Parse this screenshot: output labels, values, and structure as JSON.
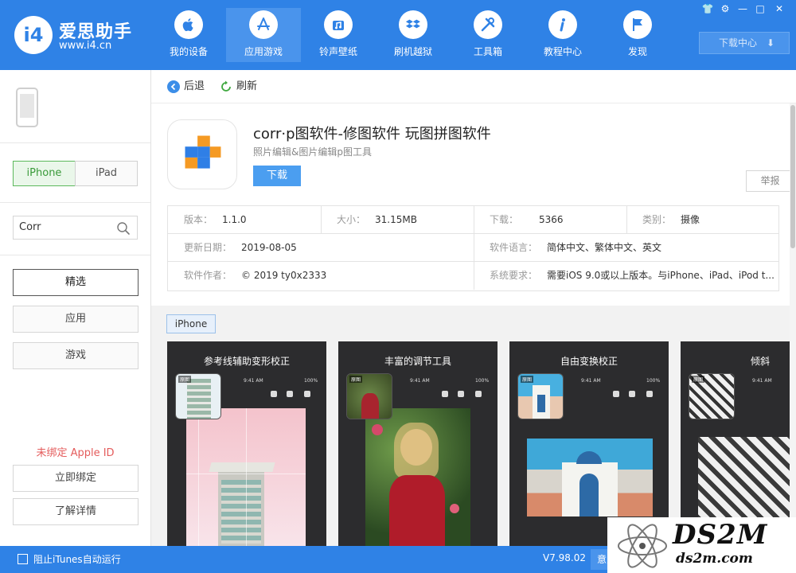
{
  "app": {
    "logo_badge": "i4",
    "name": "爱思助手",
    "url": "www.i4.cn"
  },
  "nav": {
    "items": [
      {
        "label": "我的设备",
        "icon": "apple-icon"
      },
      {
        "label": "应用游戏",
        "icon": "app-store-icon"
      },
      {
        "label": "铃声壁纸",
        "icon": "music-icon"
      },
      {
        "label": "刷机越狱",
        "icon": "dropbox-box-icon"
      },
      {
        "label": "工具箱",
        "icon": "tools-icon"
      },
      {
        "label": "教程中心",
        "icon": "info-icon"
      },
      {
        "label": "发现",
        "icon": "flag-icon"
      }
    ],
    "active_index": 1
  },
  "window_controls": {
    "shirt": "👕",
    "settings": "⚙",
    "minimize": "—",
    "maximize": "□",
    "close": "✕"
  },
  "download_center": {
    "label": "下载中心",
    "arrow": "⬇"
  },
  "sidebar": {
    "device_tabs": [
      "iPhone",
      "iPad"
    ],
    "search_value": "Corr",
    "categories": [
      "精选",
      "应用",
      "游戏"
    ],
    "apple_id_notice": "未绑定 Apple ID",
    "bind_now": "立即绑定",
    "learn_more": "了解详情"
  },
  "toolbar": {
    "back": "后退",
    "refresh": "刷新"
  },
  "app_detail": {
    "title": "corr·p图软件-修图软件 玩图拼图软件",
    "subtitle": "照片编辑&图片编辑p图工具",
    "download": "下载",
    "report": "举报",
    "info": {
      "version_k": "版本：",
      "version_v": "1.1.0",
      "size_k": "大小：",
      "size_v": "31.15MB",
      "downloads_k": "下载：",
      "downloads_v": "5366",
      "category_k": "类别：",
      "category_v": "摄像",
      "updated_k": "更新日期：",
      "updated_v": "2019-08-05",
      "language_k": "软件语言：",
      "language_v": "简体中文、繁体中文、英文",
      "author_k": "软件作者：",
      "author_v": "© 2019 ty0x2333",
      "requirement_k": "系统要求：",
      "requirement_v": "需要iOS 9.0或以上版本。与iPhone、iPad、iPod t..."
    }
  },
  "screenshots": {
    "device_tag": "iPhone",
    "status_time": "9:41 AM",
    "status_battery": "100%",
    "thumb_label": "原图",
    "items": [
      {
        "caption": "参考线辅助变形校正"
      },
      {
        "caption": "丰富的调节工具"
      },
      {
        "caption": "自由变换校正"
      },
      {
        "caption": "倾斜"
      }
    ]
  },
  "footer": {
    "itunes_label": "阻止iTunes自动运行",
    "version": "V7.98.02",
    "feedback_button": "意见反馈"
  },
  "watermark": {
    "main": "DS2M",
    "sub": "ds2m.com"
  },
  "colors": {
    "brand_blue": "#2f82e6",
    "active_green": "#5cb85c",
    "download_blue": "#4b9ef0",
    "notice_red": "#e45c5c",
    "logo_orange": "#f59a23",
    "logo_blue": "#2f7fe6"
  }
}
